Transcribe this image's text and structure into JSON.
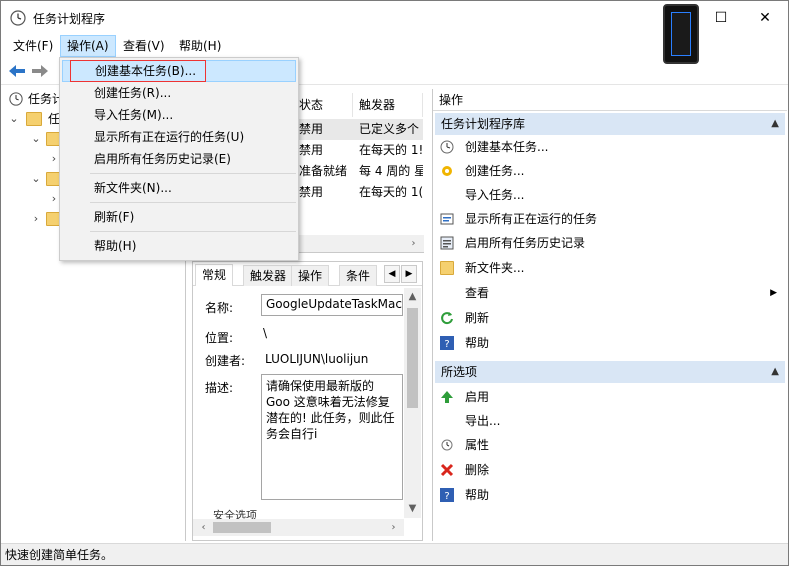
{
  "window": {
    "title": "任务计划程序",
    "minimize": "—",
    "maximize": "☐",
    "close": "✕"
  },
  "menubar": {
    "file": "文件(F)",
    "action": "操作(A)",
    "view": "查看(V)",
    "help": "帮助(H)"
  },
  "dropdown": {
    "items": [
      "创建基本任务(B)...",
      "创建任务(R)...",
      "导入任务(M)...",
      "显示所有正在运行的任务(U)",
      "启用所有任务历史记录(E)",
      "新文件夹(N)...",
      "刷新(F)",
      "帮助(H)"
    ]
  },
  "tree": {
    "root_label": "任务计",
    "library_label": "任"
  },
  "task_list": {
    "headers": [
      "状态",
      "触发器"
    ],
    "rows": [
      {
        "status": "禁用",
        "trigger": "已定义多个"
      },
      {
        "status": "禁用",
        "trigger": "在每天的 1!"
      },
      {
        "status": "准备就绪",
        "trigger": "每 4 周的 星"
      },
      {
        "status": "禁用",
        "trigger": "在每天的 1("
      }
    ]
  },
  "details": {
    "tabs": [
      "常规",
      "触发器",
      "操作",
      "条件"
    ],
    "name_label": "名称:",
    "name_value": "GoogleUpdateTaskMac",
    "location_label": "位置:",
    "location_value": "\\",
    "author_label": "创建者:",
    "author_value": "LUOLIJUN\\luolijun",
    "description_label": "描述:",
    "description_value": "请确保使用最新版的 Goo 这意味着无法修复潜在的! 此任务，则此任务会自行i",
    "security_label": "安全选项"
  },
  "actions": {
    "title": "操作",
    "section1": "任务计划程序库",
    "section1_items": [
      {
        "label": "创建基本任务...",
        "icon": "clock-icon"
      },
      {
        "label": "创建任务...",
        "icon": "create-task-icon"
      },
      {
        "label": "导入任务...",
        "icon": "blank-icon"
      },
      {
        "label": "显示所有正在运行的任务",
        "icon": "running-tasks-icon"
      },
      {
        "label": "启用所有任务历史记录",
        "icon": "history-icon"
      },
      {
        "label": "新文件夹...",
        "icon": "folder-icon"
      },
      {
        "label": "查看",
        "icon": "blank-icon"
      },
      {
        "label": "刷新",
        "icon": "refresh-icon"
      },
      {
        "label": "帮助",
        "icon": "help-icon"
      }
    ],
    "section2": "所选项",
    "section2_items": [
      {
        "label": "启用",
        "icon": "enable-icon"
      },
      {
        "label": "导出...",
        "icon": "blank-icon"
      },
      {
        "label": "属性",
        "icon": "properties-icon"
      },
      {
        "label": "删除",
        "icon": "delete-icon"
      },
      {
        "label": "帮助",
        "icon": "help-icon"
      }
    ]
  },
  "statusbar": {
    "text": "快速创建简单任务。"
  }
}
